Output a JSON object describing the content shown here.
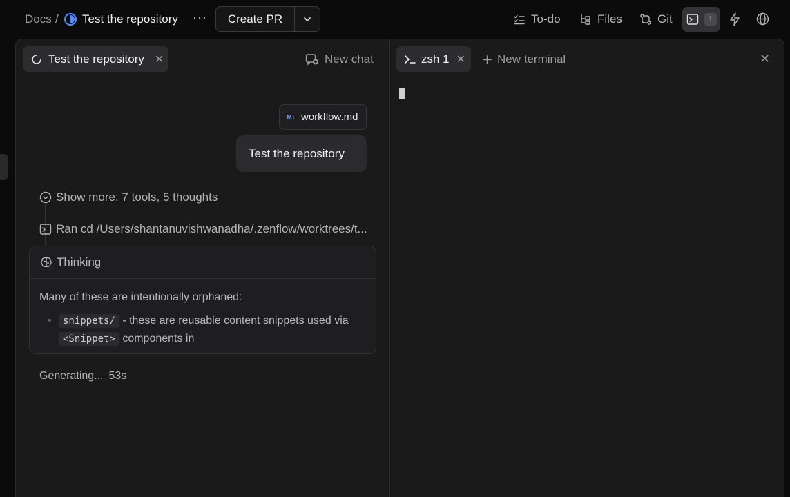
{
  "breadcrumb": {
    "root": "Docs",
    "separator": "/",
    "title": "Test the repository"
  },
  "header": {
    "more_label": "···",
    "create_pr_label": "Create PR",
    "todo_label": "To-do",
    "files_label": "Files",
    "git_label": "Git",
    "terminal_count": "1"
  },
  "chat": {
    "tab_label": "Test the repository",
    "new_chat_label": "New chat",
    "attachment": {
      "icon_text": "M↓",
      "name": "workflow.md"
    },
    "user_message": "Test the repository",
    "show_more": "Show more: 7 tools, 5 thoughts",
    "ran_command": "Ran cd /Users/shantanuvishwanadha/.zenflow/worktrees/t...",
    "thinking": {
      "title": "Thinking",
      "intro": "Many of these are intentionally orphaned:",
      "bullet_code1": "snippets/",
      "bullet_text1": "- these are reusable content snippets used",
      "bullet_text2": "via",
      "bullet_code2": "<Snippet>",
      "bullet_text3": "components in"
    },
    "status": {
      "label": "Generating...",
      "elapsed": "53s"
    }
  },
  "terminal": {
    "tab_label": "zsh 1",
    "new_terminal_label": "New terminal"
  },
  "colors": {
    "background": "#0b0b0c",
    "panel": "#1a1a1a",
    "accent": "#4d8dff"
  }
}
